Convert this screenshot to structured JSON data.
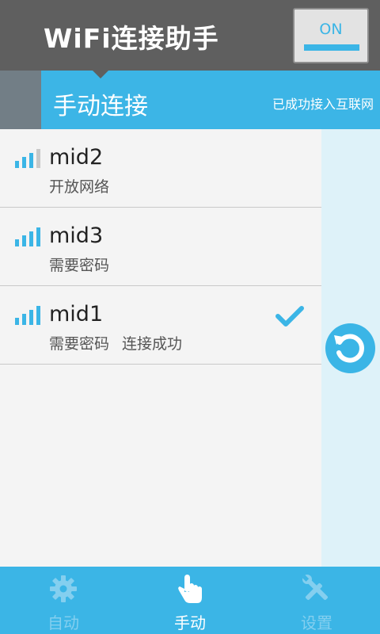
{
  "header": {
    "title": "WiFi连接助手",
    "toggle_label": "ON"
  },
  "titlebar": {
    "title": "手动连接",
    "status": "已成功接入互联网"
  },
  "networks": [
    {
      "ssid": "mid2",
      "security": "开放网络",
      "state": "",
      "signal_bars": 3,
      "connected": false
    },
    {
      "ssid": "mid3",
      "security": "需要密码",
      "state": "",
      "signal_bars": 4,
      "connected": false
    },
    {
      "ssid": "mid1",
      "security": "需要密码",
      "state": "连接成功",
      "signal_bars": 4,
      "connected": true
    }
  ],
  "nav": {
    "items": [
      {
        "label": "自动",
        "icon": "gear-icon",
        "active": false
      },
      {
        "label": "手动",
        "icon": "hand-pointer-icon",
        "active": true
      },
      {
        "label": "设置",
        "icon": "tools-icon",
        "active": false
      }
    ]
  },
  "colors": {
    "accent": "#3bb5e6",
    "header_bg": "#5f5f5f",
    "list_bg": "#f4f4f4",
    "side_panel": "#def2f9"
  }
}
